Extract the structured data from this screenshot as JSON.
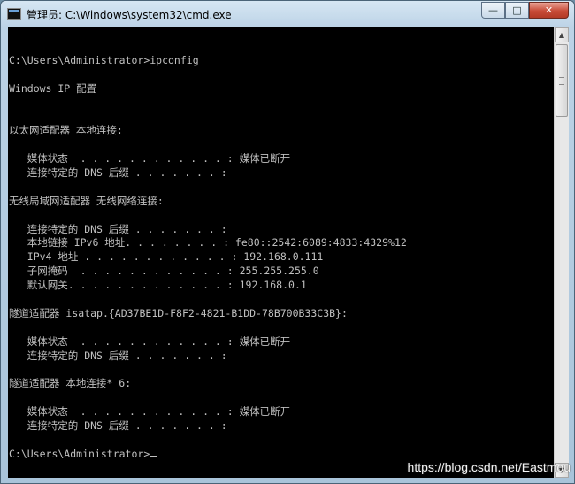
{
  "window": {
    "title": "管理员: C:\\Windows\\system32\\cmd.exe",
    "icon": "cmd-console-icon",
    "buttons": {
      "minimize": "—",
      "maximize": "□",
      "close": "✕"
    }
  },
  "console": {
    "lines": [
      "",
      "C:\\Users\\Administrator>ipconfig",
      "",
      "Windows IP 配置",
      "",
      "",
      "以太网适配器 本地连接:",
      "",
      "   媒体状态  . . . . . . . . . . . . : 媒体已断开",
      "   连接特定的 DNS 后缀 . . . . . . . :",
      "",
      "无线局域网适配器 无线网络连接:",
      "",
      "   连接特定的 DNS 后缀 . . . . . . . :",
      "   本地链接 IPv6 地址. . . . . . . . : fe80::2542:6089:4833:4329%12",
      "   IPv4 地址 . . . . . . . . . . . . : 192.168.0.111",
      "   子网掩码  . . . . . . . . . . . . : 255.255.255.0",
      "   默认网关. . . . . . . . . . . . . : 192.168.0.1",
      "",
      "隧道适配器 isatap.{AD37BE1D-F8F2-4821-B1DD-78B700B33C3B}:",
      "",
      "   媒体状态  . . . . . . . . . . . . : 媒体已断开",
      "   连接特定的 DNS 后缀 . . . . . . . :",
      "",
      "隧道适配器 本地连接* 6:",
      "",
      "   媒体状态  . . . . . . . . . . . . : 媒体已断开",
      "   连接特定的 DNS 后缀 . . . . . . . :",
      "",
      "C:\\Users\\Administrator>"
    ]
  },
  "watermark": "https://blog.csdn.net/Eastmou"
}
